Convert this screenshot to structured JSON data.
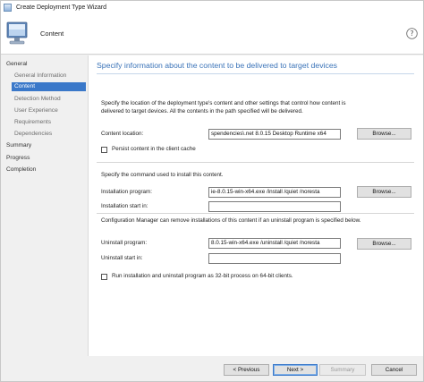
{
  "window": {
    "title": "Create Deployment Type Wizard"
  },
  "header": {
    "title": "Content"
  },
  "nav": {
    "items": [
      {
        "label": "General",
        "level": "main",
        "selected": false
      },
      {
        "label": "General Information",
        "level": "sub",
        "selected": false
      },
      {
        "label": "Content",
        "level": "sub",
        "selected": true
      },
      {
        "label": "Detection Method",
        "level": "sub",
        "selected": false
      },
      {
        "label": "User Experience",
        "level": "sub",
        "selected": false
      },
      {
        "label": "Requirements",
        "level": "sub",
        "selected": false
      },
      {
        "label": "Dependencies",
        "level": "sub",
        "selected": false
      },
      {
        "label": "Summary",
        "level": "main",
        "selected": false
      },
      {
        "label": "Progress",
        "level": "main",
        "selected": false
      },
      {
        "label": "Completion",
        "level": "main",
        "selected": false
      }
    ]
  },
  "main": {
    "heading": "Specify information about the content to be delivered to target devices",
    "description_line1": "Specify the location of the deployment type's content and other settings that control how content is",
    "description_line2": "delivered to target devices. All the contents in the path specified will be delivered.",
    "content_location": {
      "label": "Content location:",
      "value": "spendencies\\.net 8.0.15 Desktop Runtime x64",
      "browse": "Browse..."
    },
    "persist_content": {
      "label": "Persist content in the client cache",
      "checked": false
    },
    "install_section_label": "Specify the command used to install this content.",
    "installation_program": {
      "label": "Installation program:",
      "value": "ie-8.0.15-win-x64.exe /install /quiet /noresta",
      "browse": "Browse..."
    },
    "installation_start_in": {
      "label": "Installation start in:",
      "value": ""
    },
    "uninstall_section_label": "Configuration Manager can remove installations of this content if an uninstall program is specified below.",
    "uninstall_program": {
      "label": "Uninstall program:",
      "value": "8.0.15-win-x64.exe /uninstall /quiet /noresta",
      "browse": "Browse..."
    },
    "uninstall_start_in": {
      "label": "Uninstall start in:",
      "value": ""
    },
    "run_32bit": {
      "label": "Run installation and uninstall program as 32-bit process on 64-bit clients.",
      "checked": false
    }
  },
  "footer": {
    "previous": "< Previous",
    "next": "Next >",
    "summary": "Summary",
    "cancel": "Cancel"
  }
}
